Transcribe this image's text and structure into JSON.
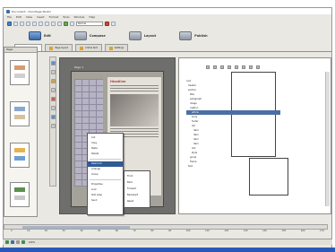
{
  "window": {
    "title": "Document - DocuPage Studio"
  },
  "menu": [
    "File",
    "Edit",
    "View",
    "Insert",
    "Format",
    "Tools",
    "Window",
    "Help"
  ],
  "toolbar": {
    "style_combo": "Normal"
  },
  "modes": [
    "Edit",
    "Compose",
    "Layout",
    "Publish"
  ],
  "doc_tabs": [
    "Document 1",
    "Page layout",
    "Article text",
    "Settings"
  ],
  "left_panel": {
    "title": "Pages"
  },
  "page": {
    "label": "Page 1",
    "article_title": "Headline"
  },
  "context_menu": {
    "items": [
      "Cut",
      "Copy",
      "Paste",
      "Delete",
      "Select all",
      "Arrange",
      "Group",
      "Properties",
      "Lock",
      "Text wrap",
      "Send"
    ],
    "highlighted_index": 4
  },
  "submenu": {
    "items": [
      "Front",
      "Back",
      "Forward",
      "Backward",
      "Reset"
    ]
  },
  "tree": {
    "nodes": [
      "root",
      "header",
      "section",
      "title",
      "paragraph",
      "image",
      "caption",
      "article",
      "body",
      "footer",
      "list",
      "item",
      "item",
      "item",
      "item",
      "link",
      "style",
      "group",
      "frame",
      "text"
    ],
    "selected_index": 7
  },
  "timeline": [
    "0",
    "10",
    "20",
    "30",
    "40",
    "50",
    "60",
    "70",
    "80",
    "90",
    "100",
    "110",
    "120",
    "130",
    "140",
    "150",
    "160",
    "170"
  ],
  "status": {
    "zoom": "100%"
  },
  "colors": {
    "accent": "#315a95",
    "canvas": "#6e6e6c",
    "taskbar": "#2a58b8"
  }
}
